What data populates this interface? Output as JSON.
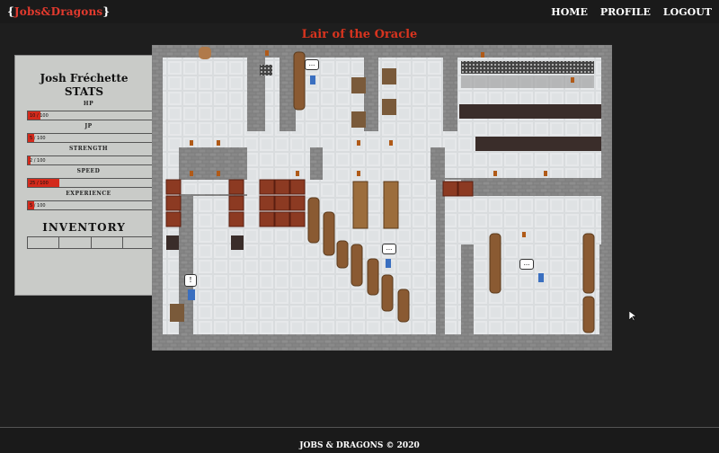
{
  "nav": {
    "logo_open": "{",
    "logo_name": "Jobs&Dragons",
    "logo_close": "}",
    "links": [
      "HOME",
      "PROFILE",
      "LOGOUT"
    ]
  },
  "map_title": "Lair of the Oracle",
  "player": {
    "name": "Josh Fréchette",
    "stats_heading": "STATS",
    "stats": [
      {
        "label": "HP",
        "value": 10,
        "max": 100,
        "text": "10 / 100"
      },
      {
        "label": "JP",
        "value": 5,
        "max": 100,
        "text": "5 / 100"
      },
      {
        "label": "STRENGTH",
        "value": 2,
        "max": 100,
        "text": "2 / 100"
      },
      {
        "label": "SPEED",
        "value": 25,
        "max": 100,
        "text": "25 / 100"
      },
      {
        "label": "EXPERIENCE",
        "value": 5,
        "max": 100,
        "text": "5 / 100"
      }
    ],
    "inventory_heading": "INVENTORY",
    "inventory_slots": 4
  },
  "colors": {
    "accent_red": "#d32a1c",
    "title_red": "#d8341f",
    "panel_bg": "#c9cbc8",
    "page_bg": "#1e1e1e"
  },
  "map": {
    "speech_bubbles": [
      "...",
      "...",
      "...",
      "!"
    ]
  },
  "footer": "JOBS & DRAGONS © 2020"
}
